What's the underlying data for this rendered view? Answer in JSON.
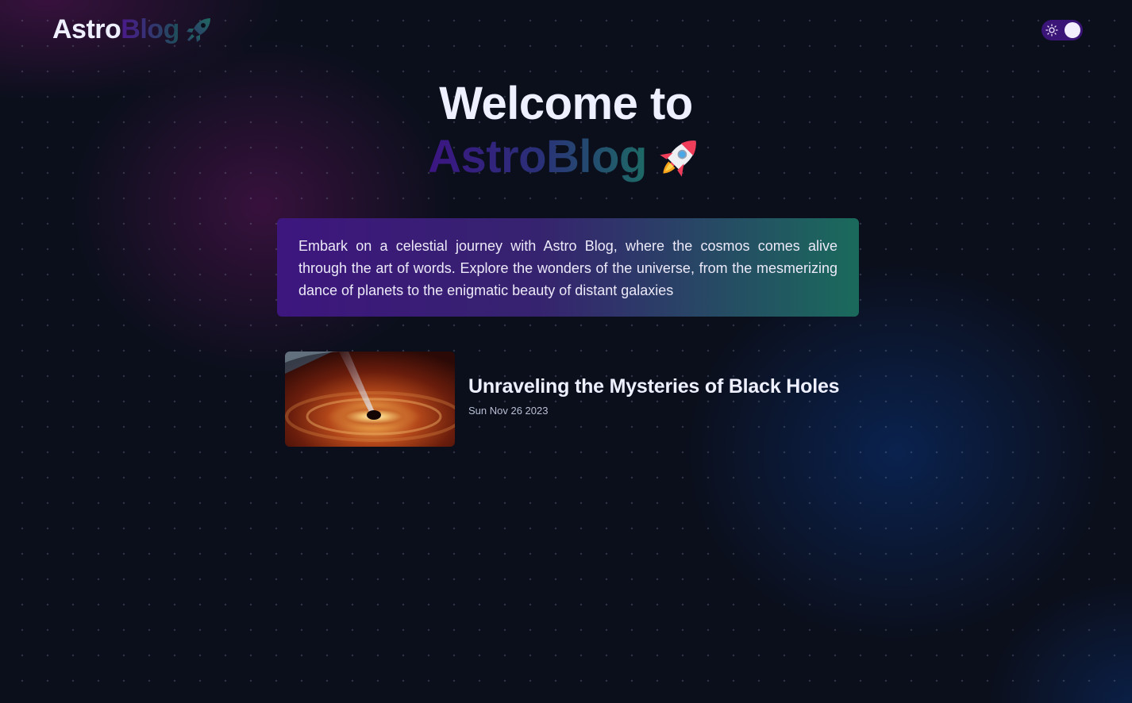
{
  "header": {
    "logo_part1": "Astro",
    "logo_part2": "Blog",
    "logo_icon": "rocket-icon",
    "theme_toggle_icon": "sun-icon"
  },
  "hero": {
    "line1": "Welcome to",
    "line2": "AstroBlog",
    "emoji_icon": "rocket-emoji-icon"
  },
  "intro": {
    "text": "Embark on a celestial journey with Astro Blog, where the cosmos comes alive through the art of words. Explore the wonders of the universe, from the mesmerizing dance of planets to the enigmatic beauty of distant galaxies"
  },
  "posts": [
    {
      "title": "Unraveling the Mysteries of Black Holes",
      "date": "Sun Nov 26 2023",
      "thumbnail_icon": "black-hole-image"
    }
  ],
  "colors": {
    "background": "#0b0f1c",
    "accent_purple": "#3d167e",
    "accent_teal": "#1a6a5c",
    "toggle_bg": "#3a1577"
  }
}
